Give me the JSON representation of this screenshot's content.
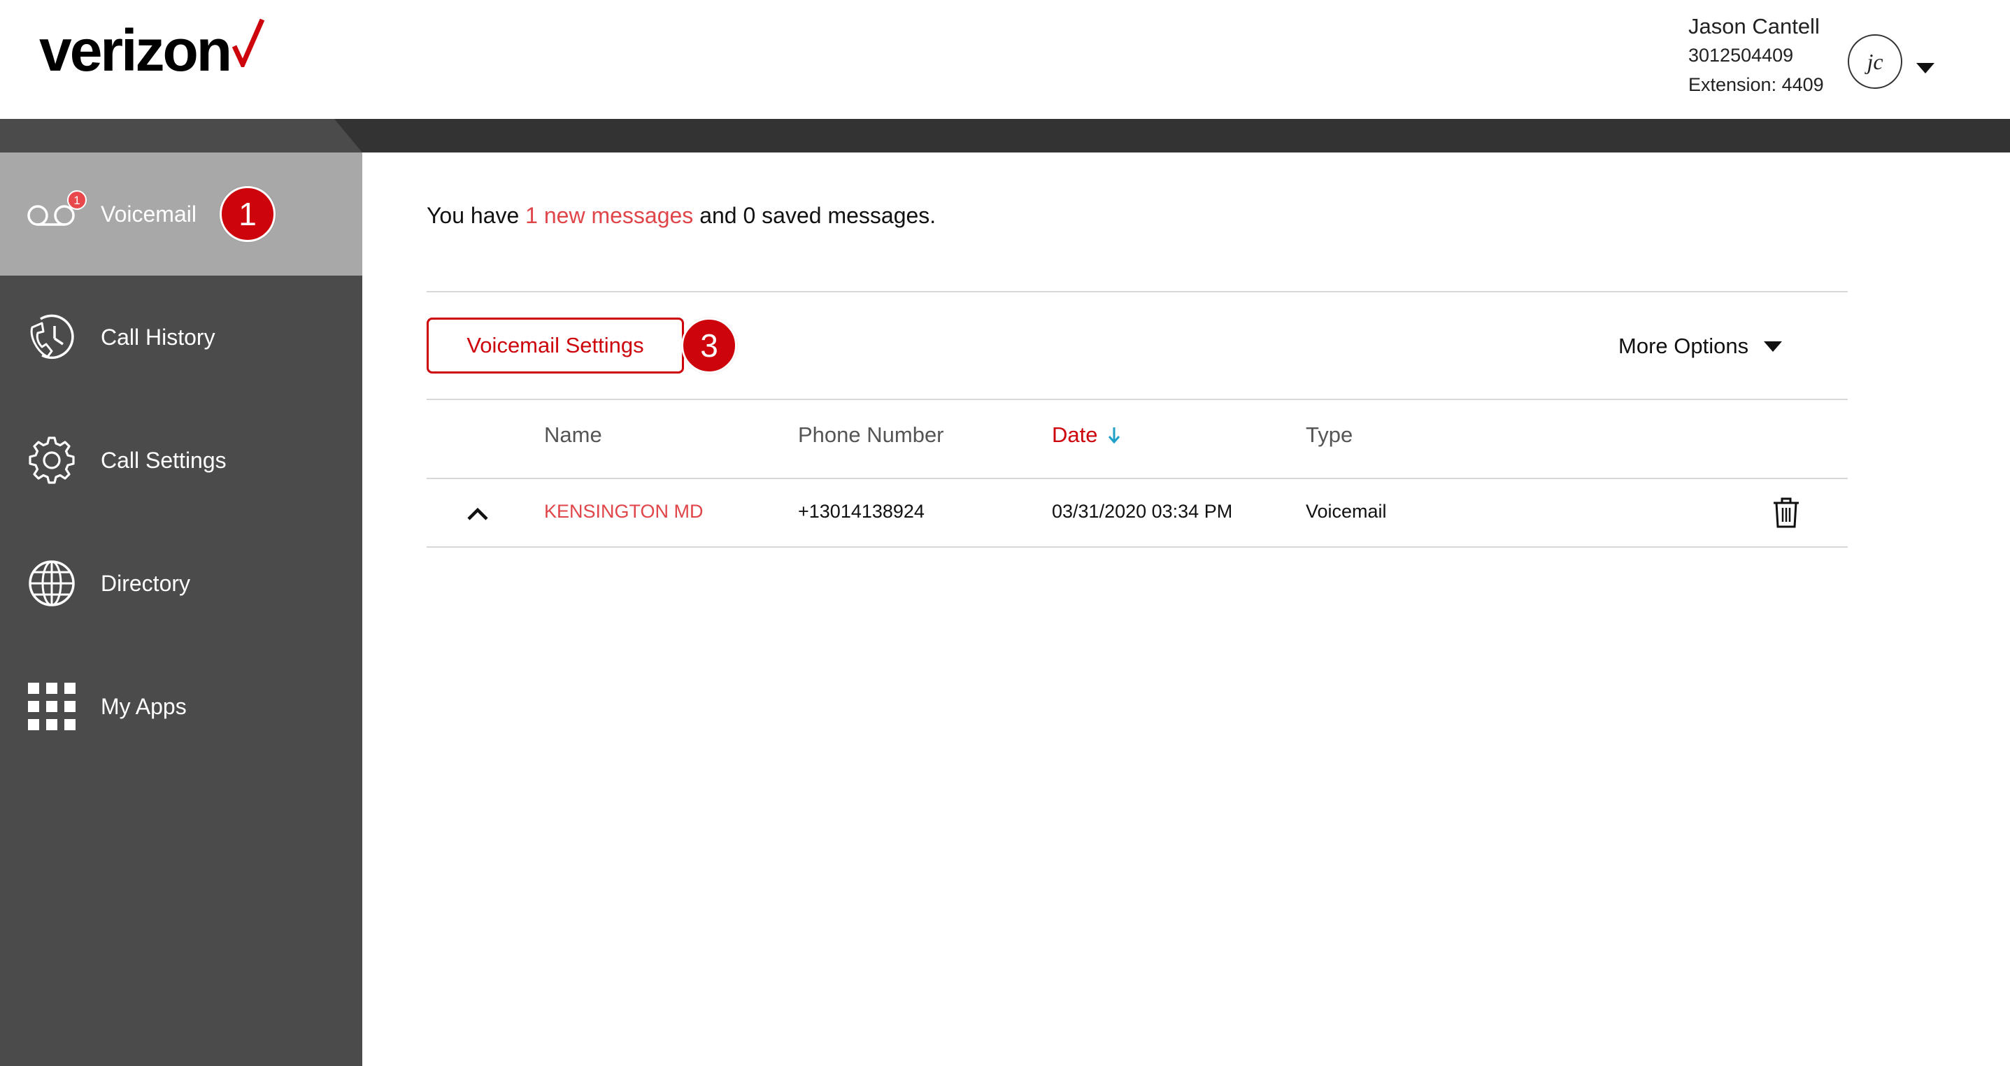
{
  "brand": {
    "logo_text": "verizon",
    "accent_color": "#cd040b"
  },
  "user": {
    "name": "Jason Cantell",
    "phone": "3012504409",
    "extension": "Extension: 4409",
    "avatar_initials": "jc"
  },
  "sidebar": {
    "items": [
      {
        "label": "Voicemail",
        "icon": "voicemail-icon",
        "active": true,
        "badge": "1"
      },
      {
        "label": "Call History",
        "icon": "call-history-icon",
        "active": false
      },
      {
        "label": "Call Settings",
        "icon": "gear-icon",
        "active": false
      },
      {
        "label": "Directory",
        "icon": "globe-icon",
        "active": false
      },
      {
        "label": "My Apps",
        "icon": "app-grid-icon",
        "active": false
      }
    ]
  },
  "callouts": {
    "voicemail": "1",
    "settings": "3"
  },
  "main": {
    "summary_prefix": "You have ",
    "summary_link": "1 new messages",
    "summary_suffix": " and 0 saved messages.",
    "voicemail_settings_label": "Voicemail Settings",
    "more_options_label": "More Options"
  },
  "table": {
    "columns": [
      "Name",
      "Phone Number",
      "Date",
      "Type"
    ],
    "sorted_column": "Date",
    "sort_direction": "descending",
    "rows": [
      {
        "name": "KENSINGTON MD",
        "phone": "+13014138924",
        "date": "03/31/2020 03:34 PM",
        "type": "Voicemail"
      }
    ]
  }
}
